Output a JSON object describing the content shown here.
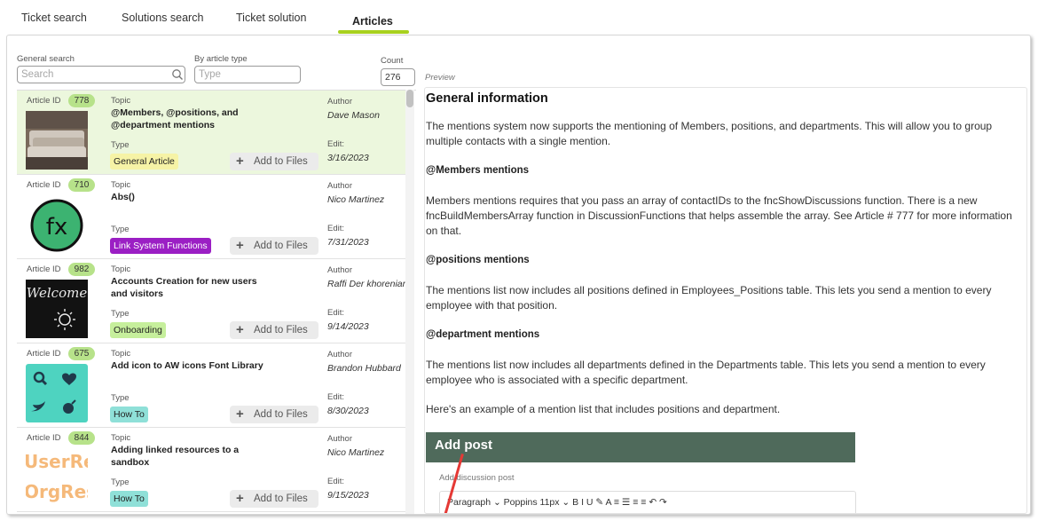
{
  "tabs": [
    {
      "label": "Ticket search",
      "active": false
    },
    {
      "label": "Solutions search",
      "active": false
    },
    {
      "label": "Ticket solution",
      "active": false
    },
    {
      "label": "Articles",
      "active": true
    }
  ],
  "filters": {
    "general_search_label": "General search",
    "general_search_placeholder": "Search",
    "article_type_label": "By article type",
    "article_type_placeholder": "Type",
    "count_label": "Count",
    "count_value": "276"
  },
  "preview_label": "Preview",
  "list_labels": {
    "article_id": "Article ID",
    "topic": "Topic",
    "type": "Type",
    "author": "Author",
    "edit": "Edit:",
    "add_to_files": "Add to Files"
  },
  "articles": [
    {
      "id": "778",
      "topic": "@Members, @positions, and @department mentions",
      "type": "General Article",
      "type_color": "#f6f3a6",
      "type_text_color": "#222222",
      "author": "Dave Mason",
      "edit": "3/16/2023",
      "selected": true
    },
    {
      "id": "710",
      "topic": "Abs()",
      "type": "Link System Functions",
      "type_color": "#9b1fc4",
      "type_text_color": "#ffffff",
      "author": "Nico Martinez",
      "edit": "7/31/2023",
      "selected": false
    },
    {
      "id": "982",
      "topic": "Accounts Creation for new users and visitors",
      "type": "Onboarding",
      "type_color": "#c6ef9c",
      "type_text_color": "#222222",
      "author": "Raffi Der khorenian",
      "edit": "9/14/2023",
      "selected": false
    },
    {
      "id": "675",
      "topic": "Add icon to AW icons Font Library",
      "type": "How To",
      "type_color": "#8fe0d8",
      "type_text_color": "#222222",
      "author": "Brandon Hubbard",
      "edit": "8/30/2023",
      "selected": false
    },
    {
      "id": "844",
      "topic": "Adding linked resources to a sandbox",
      "type": "How To",
      "type_color": "#8fe0d8",
      "type_text_color": "#222222",
      "author": "Nico Martinez",
      "edit": "9/15/2023",
      "selected": false
    }
  ],
  "thumbs": {
    "welcome_text": "Welcome",
    "fx_text": "fx",
    "userres_line1": "UserRes",
    "userres_line2": "OrgResc"
  },
  "preview": {
    "title": "General information",
    "p1": "The mentions system now supports the mentioning of Members, positions, and departments.  This will allow you to group multiple contacts with a single mention.",
    "h_members": "@Members mentions",
    "p2": "Members mentions requires that you pass an array of contactIDs to the fncShowDiscussions function.  There is a new fncBuildMembersArray function in DiscussionFunctions that helps assemble the array.  See Article # 777 for more information on that.",
    "h_positions": "@positions mentions",
    "p3": "The mentions list now includes all positions defined in Employees_Positions table.  This lets you send a mention to every employee with that position.",
    "h_department": "@department mentions",
    "p4": "The mentions list now includes all departments defined in the Departments table.  This lets you send a mention to every employee who is associated with a specific department.",
    "p5": "Here's an example of a mention list that includes positions and department.",
    "embed_title": "Add post",
    "embed_sub": "Add discussion post",
    "embed_toolbar": "Paragraph ⌄   Poppins   11px ⌄   B   I   U   ✎   A   ≡   ☰   ≡   ≡   ↶   ↷"
  }
}
